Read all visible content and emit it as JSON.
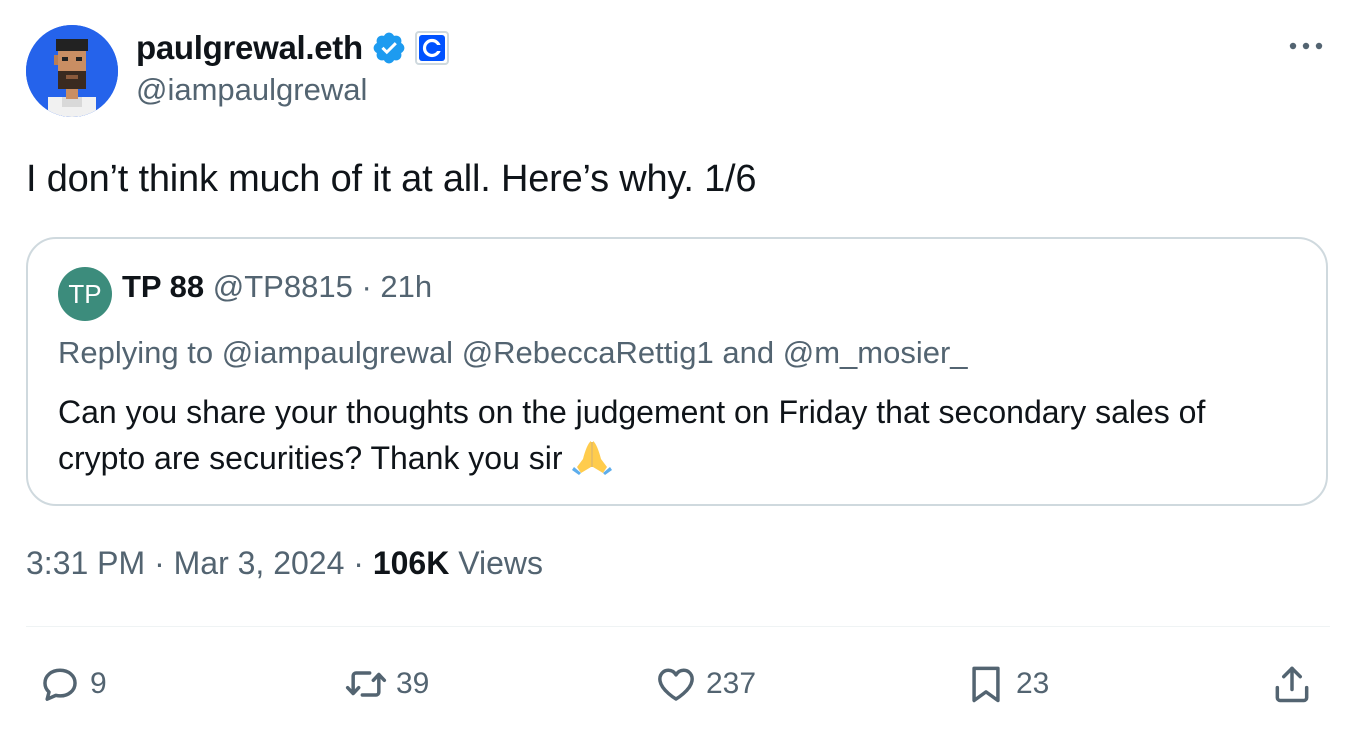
{
  "author": {
    "display_name": "paulgrewal.eth",
    "handle": "@iampaulgrewal",
    "verified_icon": "verified-badge-icon",
    "affiliation_icon": "coinbase-logo-icon",
    "avatar_bg": "#2563eb"
  },
  "tweet": {
    "text": "I don’t think much of it at all. Here’s why. 1/6"
  },
  "quoted": {
    "avatar_initials": "TP",
    "avatar_bg": "#3c8c7c",
    "display_name": "TP 88",
    "handle": "@TP8815",
    "separator": "·",
    "time": "21h",
    "replying_prefix": "Replying to",
    "reply_user_1": "@iampaulgrewal",
    "reply_user_2": "@RebeccaRettig1",
    "reply_and": "and",
    "reply_user_3": "@m_mosier_",
    "text": "Can you share your thoughts on the judgement on Friday that secondary sales of crypto are securities? Thank you sir",
    "emoji_icon": "folded-hands-emoji"
  },
  "meta": {
    "time": "3:31 PM",
    "sep": "·",
    "date": "Mar 3, 2024",
    "views_count": "106K",
    "views_label": "Views"
  },
  "actions": {
    "replies": "9",
    "reposts": "39",
    "likes": "237",
    "bookmarks": "23"
  },
  "colors": {
    "text": "#0f1419",
    "muted": "#536471",
    "border": "#cfd9de",
    "verified": "#1d9bf0"
  }
}
